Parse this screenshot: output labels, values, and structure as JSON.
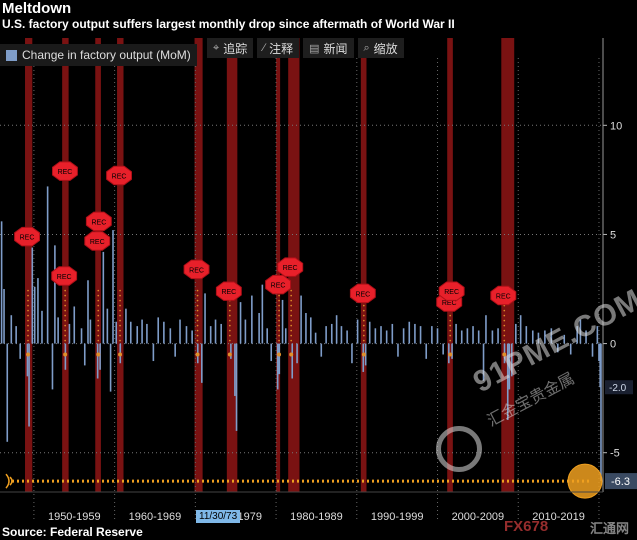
{
  "header": {
    "title": "Meltdown",
    "subtitle": "U.S. factory output suffers largest monthly drop since aftermath of World War II"
  },
  "toolbar": [
    {
      "icon": "crosshair-icon",
      "glyph": "⌖",
      "label": "追踪"
    },
    {
      "icon": "pencil-icon",
      "glyph": "∕",
      "label": "注释"
    },
    {
      "icon": "news-icon",
      "glyph": "▤",
      "label": "新闻"
    },
    {
      "icon": "zoom-icon",
      "glyph": "⌕",
      "label": "缩放"
    }
  ],
  "legend": {
    "label": "Change in factory output (MoM)",
    "color": "#7f9dc9"
  },
  "source": "Source: Federal Reserve",
  "date_tag": "11/30/73",
  "watermark": {
    "site": "91PME.COM",
    "cn": "汇金宝贵金属",
    "fx": "FX678",
    "hui": "汇通网"
  },
  "chart_data": {
    "type": "bar",
    "title": "Meltdown",
    "subtitle": "U.S. factory output suffers largest monthly drop since aftermath of World War II",
    "series": [
      {
        "name": "Change in factory output (MoM)",
        "color": "#7f9dc9"
      }
    ],
    "y_axis": {
      "side": "right",
      "ylim": [
        -6.8,
        14
      ],
      "ticks": [
        10,
        5,
        0,
        -5
      ]
    },
    "x_axis": {
      "xlim": [
        1945.8,
        2020.5
      ],
      "ticks": [
        "1950-1959",
        "1960-1969",
        "1970-1979",
        "1980-1989",
        "1990-1999",
        "2000-2009",
        "2010-2019"
      ]
    },
    "grid": true,
    "recessions": [
      [
        1948.9,
        1949.8
      ],
      [
        1953.5,
        1954.3
      ],
      [
        1957.6,
        1958.3
      ],
      [
        1960.3,
        1961.1
      ],
      [
        1969.9,
        1970.9
      ],
      [
        1973.9,
        1975.2
      ],
      [
        1980.0,
        1980.5
      ],
      [
        1981.5,
        1982.9
      ],
      [
        1990.5,
        1991.2
      ],
      [
        2001.2,
        2001.9
      ],
      [
        2007.9,
        2009.5
      ]
    ],
    "rec_label": "REC",
    "bars": [
      {
        "x": 1946.0,
        "y": 5.6
      },
      {
        "x": 1946.3,
        "y": 2.5
      },
      {
        "x": 1946.7,
        "y": -4.5
      },
      {
        "x": 1947.2,
        "y": 1.3
      },
      {
        "x": 1947.8,
        "y": 0.8
      },
      {
        "x": 1948.3,
        "y": -0.7
      },
      {
        "x": 1949.2,
        "y": -1.5
      },
      {
        "x": 1949.4,
        "y": -3.8
      },
      {
        "x": 1949.8,
        "y": 4.4
      },
      {
        "x": 1950.1,
        "y": 2.6
      },
      {
        "x": 1950.5,
        "y": 3.0
      },
      {
        "x": 1951.0,
        "y": 1.5
      },
      {
        "x": 1951.7,
        "y": 7.2
      },
      {
        "x": 1952.3,
        "y": -2.1
      },
      {
        "x": 1952.6,
        "y": 4.5
      },
      {
        "x": 1953.0,
        "y": 1.2
      },
      {
        "x": 1953.9,
        "y": -1.2
      },
      {
        "x": 1954.4,
        "y": 0.9
      },
      {
        "x": 1955.0,
        "y": 1.7
      },
      {
        "x": 1955.9,
        "y": 0.7
      },
      {
        "x": 1956.3,
        "y": -1.0
      },
      {
        "x": 1956.7,
        "y": 2.9
      },
      {
        "x": 1957.0,
        "y": 1.1
      },
      {
        "x": 1957.9,
        "y": -1.6
      },
      {
        "x": 1958.2,
        "y": -1.2
      },
      {
        "x": 1958.6,
        "y": 4.2
      },
      {
        "x": 1959.1,
        "y": 1.6
      },
      {
        "x": 1959.5,
        "y": -2.2
      },
      {
        "x": 1959.8,
        "y": 5.2
      },
      {
        "x": 1960.2,
        "y": 1.0
      },
      {
        "x": 1960.7,
        "y": -0.9
      },
      {
        "x": 1961.4,
        "y": 1.6
      },
      {
        "x": 1962.0,
        "y": 1.0
      },
      {
        "x": 1962.8,
        "y": 0.8
      },
      {
        "x": 1963.4,
        "y": 1.1
      },
      {
        "x": 1964.0,
        "y": 0.9
      },
      {
        "x": 1964.8,
        "y": -0.8
      },
      {
        "x": 1965.4,
        "y": 1.2
      },
      {
        "x": 1966.1,
        "y": 1.0
      },
      {
        "x": 1966.9,
        "y": 0.7
      },
      {
        "x": 1967.5,
        "y": -0.6
      },
      {
        "x": 1968.1,
        "y": 1.1
      },
      {
        "x": 1968.9,
        "y": 0.8
      },
      {
        "x": 1969.6,
        "y": 0.6
      },
      {
        "x": 1970.3,
        "y": -0.9
      },
      {
        "x": 1970.8,
        "y": -1.8
      },
      {
        "x": 1971.2,
        "y": 2.3
      },
      {
        "x": 1971.9,
        "y": 0.8
      },
      {
        "x": 1972.5,
        "y": 1.1
      },
      {
        "x": 1973.2,
        "y": 0.9
      },
      {
        "x": 1974.4,
        "y": -0.7
      },
      {
        "x": 1974.9,
        "y": -2.4
      },
      {
        "x": 1975.1,
        "y": -4.0
      },
      {
        "x": 1975.6,
        "y": 1.9
      },
      {
        "x": 1976.2,
        "y": 1.1
      },
      {
        "x": 1977.0,
        "y": 2.2
      },
      {
        "x": 1977.9,
        "y": 1.4
      },
      {
        "x": 1978.3,
        "y": 2.7
      },
      {
        "x": 1978.9,
        "y": 0.7
      },
      {
        "x": 1979.4,
        "y": -0.8
      },
      {
        "x": 1980.2,
        "y": -2.1
      },
      {
        "x": 1980.4,
        "y": -1.4
      },
      {
        "x": 1980.8,
        "y": 2.0
      },
      {
        "x": 1981.2,
        "y": 0.7
      },
      {
        "x": 1982.0,
        "y": -1.6
      },
      {
        "x": 1982.6,
        "y": -0.9
      },
      {
        "x": 1983.1,
        "y": 2.2
      },
      {
        "x": 1983.7,
        "y": 1.4
      },
      {
        "x": 1984.3,
        "y": 1.2
      },
      {
        "x": 1984.9,
        "y": 0.5
      },
      {
        "x": 1985.6,
        "y": -0.6
      },
      {
        "x": 1986.2,
        "y": 0.8
      },
      {
        "x": 1986.9,
        "y": 0.9
      },
      {
        "x": 1987.5,
        "y": 1.3
      },
      {
        "x": 1988.1,
        "y": 0.8
      },
      {
        "x": 1988.8,
        "y": 0.6
      },
      {
        "x": 1989.4,
        "y": -0.9
      },
      {
        "x": 1990.1,
        "y": 1.1
      },
      {
        "x": 1990.8,
        "y": -1.3
      },
      {
        "x": 1991.1,
        "y": -1.0
      },
      {
        "x": 1991.6,
        "y": 1.0
      },
      {
        "x": 1992.3,
        "y": 0.7
      },
      {
        "x": 1993.0,
        "y": 0.8
      },
      {
        "x": 1993.7,
        "y": 0.6
      },
      {
        "x": 1994.4,
        "y": 0.9
      },
      {
        "x": 1995.1,
        "y": -0.6
      },
      {
        "x": 1995.8,
        "y": 0.7
      },
      {
        "x": 1996.5,
        "y": 1.0
      },
      {
        "x": 1997.2,
        "y": 0.9
      },
      {
        "x": 1997.9,
        "y": 0.8
      },
      {
        "x": 1998.6,
        "y": -0.7
      },
      {
        "x": 1999.3,
        "y": 0.8
      },
      {
        "x": 2000.0,
        "y": 0.7
      },
      {
        "x": 2000.7,
        "y": -0.5
      },
      {
        "x": 2001.4,
        "y": -0.9
      },
      {
        "x": 2001.8,
        "y": -0.7
      },
      {
        "x": 2002.3,
        "y": 0.9
      },
      {
        "x": 2003.0,
        "y": 0.6
      },
      {
        "x": 2003.7,
        "y": 0.7
      },
      {
        "x": 2004.4,
        "y": 0.8
      },
      {
        "x": 2005.1,
        "y": 0.6
      },
      {
        "x": 2005.7,
        "y": -1.7
      },
      {
        "x": 2006.0,
        "y": 1.3
      },
      {
        "x": 2006.8,
        "y": 0.6
      },
      {
        "x": 2007.5,
        "y": 0.7
      },
      {
        "x": 2008.3,
        "y": -0.9
      },
      {
        "x": 2008.7,
        "y": -3.5
      },
      {
        "x": 2008.9,
        "y": -2.1
      },
      {
        "x": 2009.2,
        "y": -1.5
      },
      {
        "x": 2009.7,
        "y": 0.9
      },
      {
        "x": 2010.3,
        "y": 1.3
      },
      {
        "x": 2011.0,
        "y": 0.8
      },
      {
        "x": 2011.8,
        "y": 0.6
      },
      {
        "x": 2012.5,
        "y": 0.5
      },
      {
        "x": 2013.3,
        "y": 0.6
      },
      {
        "x": 2014.1,
        "y": 0.7
      },
      {
        "x": 2014.9,
        "y": -0.4
      },
      {
        "x": 2015.7,
        "y": 0.4
      },
      {
        "x": 2016.5,
        "y": -0.5
      },
      {
        "x": 2017.3,
        "y": 0.8
      },
      {
        "x": 2017.7,
        "y": 1.1
      },
      {
        "x": 2018.4,
        "y": 0.6
      },
      {
        "x": 2019.2,
        "y": -0.6
      },
      {
        "x": 2019.8,
        "y": 0.8
      },
      {
        "x": 2020.0,
        "y": -0.8
      },
      {
        "x": 2020.15,
        "y": -2.0
      },
      {
        "x": 2020.25,
        "y": -6.3
      }
    ],
    "recession_markers": [
      {
        "x": 1948.9,
        "y": 4.9
      },
      {
        "x": 1953.5,
        "y": 3.1
      },
      {
        "x": 1953.6,
        "y": 7.9
      },
      {
        "x": 1957.6,
        "y": 4.7
      },
      {
        "x": 1957.8,
        "y": 5.6
      },
      {
        "x": 1960.3,
        "y": 7.7
      },
      {
        "x": 1969.9,
        "y": 3.4
      },
      {
        "x": 1973.9,
        "y": 2.4
      },
      {
        "x": 1980.0,
        "y": 2.7
      },
      {
        "x": 1981.5,
        "y": 3.5
      },
      {
        "x": 1990.5,
        "y": 2.3
      },
      {
        "x": 2001.2,
        "y": 1.9
      },
      {
        "x": 2001.5,
        "y": 2.4
      },
      {
        "x": 2007.9,
        "y": 2.2
      }
    ],
    "highlight": {
      "value": -6.3,
      "label": "-6.3",
      "reference_line": true
    },
    "second_label": {
      "value": -2.0,
      "label": "-2.0"
    }
  }
}
